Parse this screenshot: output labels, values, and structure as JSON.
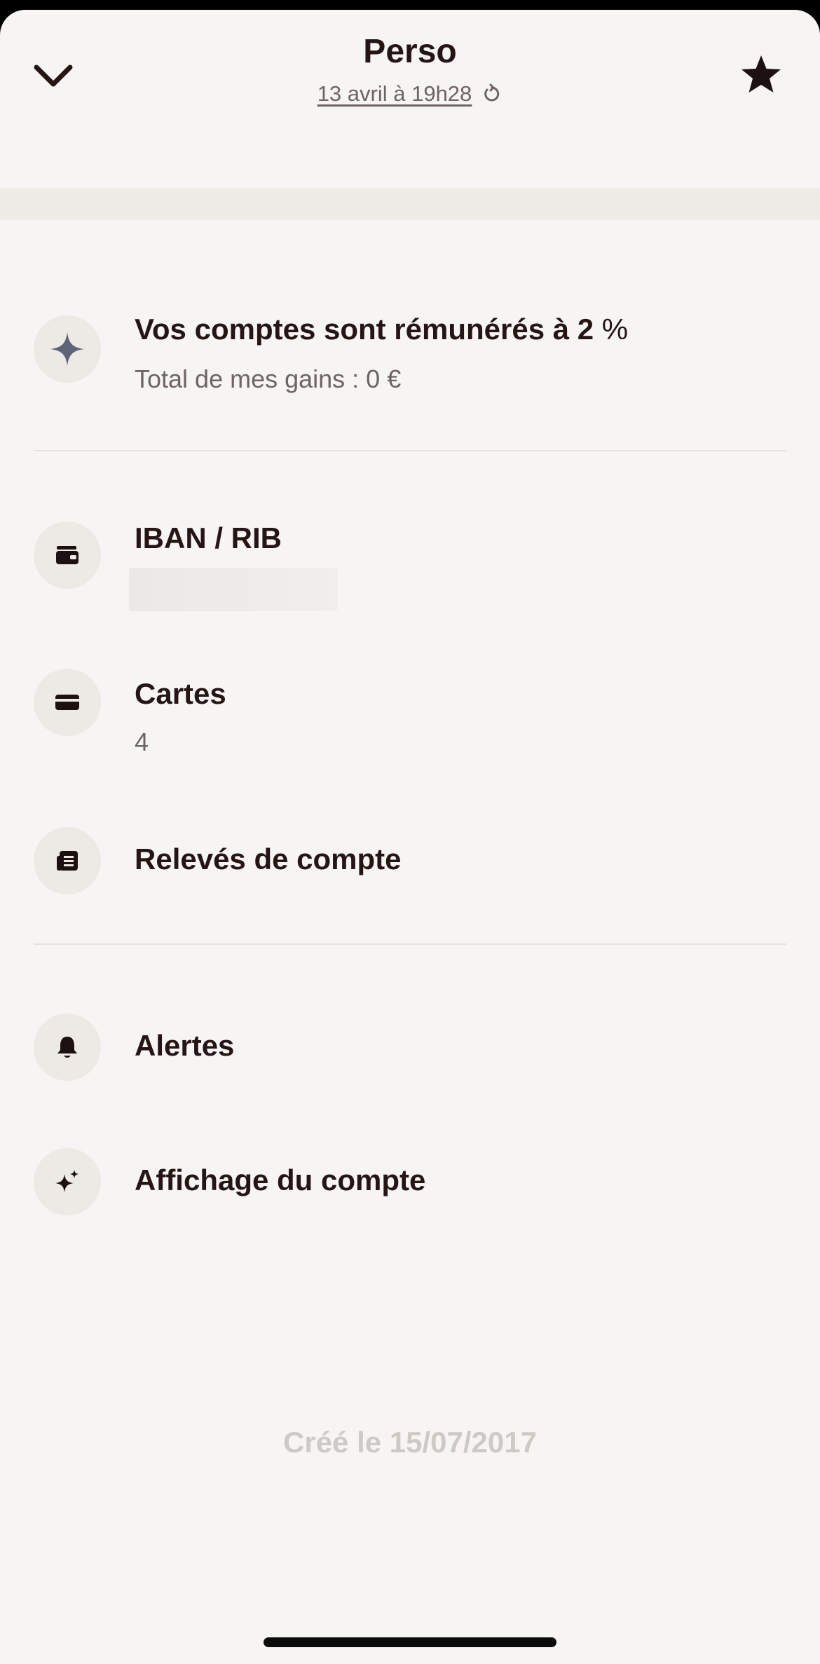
{
  "header": {
    "title": "Perso",
    "last_update": "13 avril à 19h28",
    "collapse_icon": "chevron-down-icon",
    "favorite_icon": "star-icon",
    "refresh_icon": "refresh-icon"
  },
  "interest": {
    "title_prefix": "Vos comptes sont rémunérés à ",
    "rate": "2",
    "percent": " %",
    "subtitle": "Total de mes gains : 0 €",
    "icon": "sparkle-icon",
    "icon_color": "#5b6478"
  },
  "iban": {
    "title": "IBAN / RIB",
    "icon": "wallet-icon"
  },
  "cards": {
    "title": "Cartes",
    "count": "4",
    "icon": "card-icon"
  },
  "statements": {
    "title": "Relevés de compte",
    "icon": "document-icon"
  },
  "alerts": {
    "title": "Alertes",
    "icon": "bell-icon"
  },
  "display": {
    "title": "Affichage du compte",
    "icon": "sparkles-icon"
  },
  "footer": {
    "created": "Créé le 15/07/2017"
  },
  "colors": {
    "background": "#f7f5f3",
    "text": "#261515",
    "muted": "#6e6462",
    "icon_bg": "#ede9e5"
  }
}
